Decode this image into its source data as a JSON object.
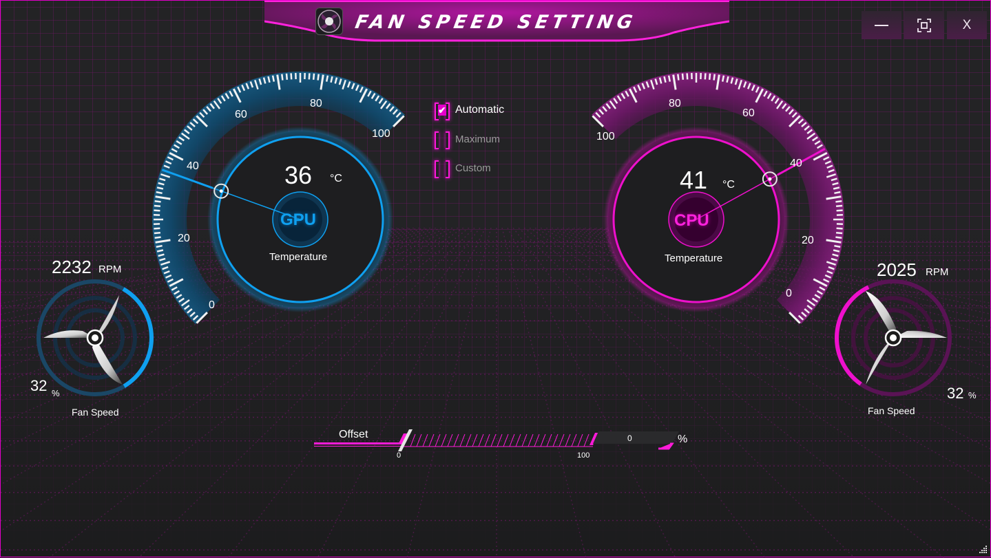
{
  "window": {
    "title": "FAN SPEED SETTING",
    "icons": {
      "app": "fan-icon",
      "minimize": "minimize-icon",
      "maximize": "maximize-icon",
      "close": "close-icon"
    },
    "minimize_glyph": "—",
    "close_glyph": "X"
  },
  "colors": {
    "gpu_accent": "#0fa0f0",
    "cpu_accent": "#ee10cc",
    "frame_accent": "#e100c8"
  },
  "gpu": {
    "badge": "GPU",
    "temperature": "36",
    "temperature_value": 36,
    "unit": "°C",
    "label": "Temperature",
    "scale_labels": [
      "0",
      "20",
      "40",
      "60",
      "80",
      "100"
    ],
    "scale_range": [
      0,
      100
    ],
    "fan": {
      "rpm": "2232",
      "rpm_unit": "RPM",
      "percent": "32",
      "percent_value": 32,
      "percent_unit": "%",
      "label": "Fan Speed"
    }
  },
  "cpu": {
    "badge": "CPU",
    "temperature": "41",
    "temperature_value": 41,
    "unit": "°C",
    "label": "Temperature",
    "scale_labels": [
      "0",
      "20",
      "40",
      "60",
      "80",
      "100"
    ],
    "scale_range": [
      0,
      100
    ],
    "fan": {
      "rpm": "2025",
      "rpm_unit": "RPM",
      "percent": "32",
      "percent_value": 32,
      "percent_unit": "%",
      "label": "Fan Speed"
    }
  },
  "modes": [
    {
      "label": "Automatic",
      "checked": true,
      "check_glyph": "✔"
    },
    {
      "label": "Maximum",
      "checked": false
    },
    {
      "label": "Custom",
      "checked": false
    }
  ],
  "offset": {
    "label": "Offset",
    "min_label": "0",
    "max_label": "100",
    "value": "0",
    "value_number": 0,
    "unit": "%"
  }
}
